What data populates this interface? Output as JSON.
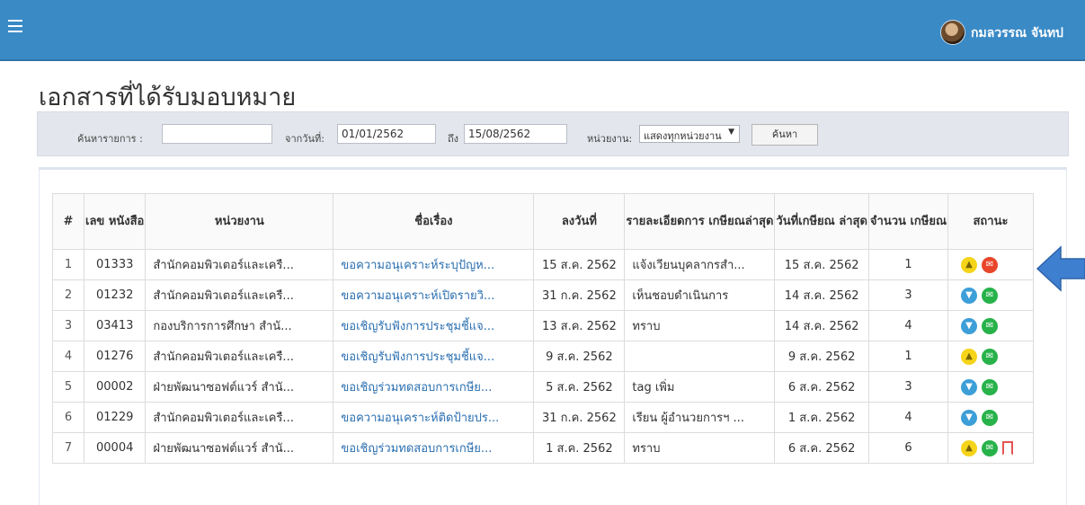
{
  "header": {
    "user_name": "กมลวรรณ จันทป",
    "menu_icon": "hamburger-icon",
    "avatar_icon": "user-avatar"
  },
  "page": {
    "title": "เอกสารที่ได้รับมอบหมาย"
  },
  "filter": {
    "search_label": "ค้นหารายการ :",
    "search_value": "",
    "from_label": "จากวันที่:",
    "from_value": "01/01/2562",
    "to_label": "ถึง",
    "to_value": "15/08/2562",
    "unit_label": "หน่วยงาน:",
    "unit_selected": "แสดงทุกหน่วยงาน",
    "search_button": "ค้นหา"
  },
  "table": {
    "columns": [
      "#",
      "เลข หนังสือ",
      "หน่วยงาน",
      "ชื่อเรื่อง",
      "ลงวันที่",
      "รายละเอียดการ เกษียณล่าสุด",
      "วันที่เกษียณ ล่าสุด",
      "จำนวน เกษียณ",
      "สถานะ"
    ],
    "rows": [
      {
        "no": "1",
        "doc_no": "01333",
        "unit": "สำนักคอมพิวเตอร์และเครื...",
        "subject": "ขอความอนุเคราะห์ระบุปัญห...",
        "date": "15 ส.ค. 2562",
        "detail": "แจ้งเวียนบุคลากรสำ...",
        "last_date": "15 ส.ค. 2562",
        "count": "1",
        "status": [
          "yellow",
          "red"
        ]
      },
      {
        "no": "2",
        "doc_no": "01232",
        "unit": "สำนักคอมพิวเตอร์และเครื...",
        "subject": "ขอความอนุเคราะห์เปิดรายวิ...",
        "date": "31 ก.ค. 2562",
        "detail": "เห็นชอบดำเนินการ",
        "last_date": "14 ส.ค. 2562",
        "count": "3",
        "status": [
          "blue",
          "green"
        ]
      },
      {
        "no": "3",
        "doc_no": "03413",
        "unit": "กองบริการการศึกษา สำนั...",
        "subject": "ขอเชิญรับฟังการประชุมชี้แจ...",
        "date": "13 ส.ค. 2562",
        "detail": "ทราบ",
        "last_date": "14 ส.ค. 2562",
        "count": "4",
        "status": [
          "blue",
          "green"
        ]
      },
      {
        "no": "4",
        "doc_no": "01276",
        "unit": "สำนักคอมพิวเตอร์และเครื...",
        "subject": "ขอเชิญรับฟังการประชุมชี้แจ...",
        "date": "9 ส.ค. 2562",
        "detail": "",
        "last_date": "9 ส.ค. 2562",
        "count": "1",
        "status": [
          "yellow",
          "green"
        ]
      },
      {
        "no": "5",
        "doc_no": "00002",
        "unit": "ฝ่ายพัฒนาซอฟต์แวร์ สำนั...",
        "subject": "ขอเชิญร่วมทดสอบการเกษีย...",
        "date": "5 ส.ค. 2562",
        "detail": "tag เพิ่ม",
        "last_date": "6 ส.ค. 2562",
        "count": "3",
        "status": [
          "blue",
          "green"
        ]
      },
      {
        "no": "6",
        "doc_no": "01229",
        "unit": "สำนักคอมพิวเตอร์และเครื...",
        "subject": "ขอความอนุเคราะห์ติดป้ายปร...",
        "date": "31 ก.ค. 2562",
        "detail": "เรียน ผู้อำนวยการฯ ...",
        "last_date": "1 ส.ค. 2562",
        "count": "4",
        "status": [
          "blue",
          "green"
        ]
      },
      {
        "no": "7",
        "doc_no": "00004",
        "unit": "ฝ่ายพัฒนาซอฟต์แวร์ สำนั...",
        "subject": "ขอเชิญร่วมทดสอบการเกษีย...",
        "date": "1 ส.ค. 2562",
        "detail": "ทราบ",
        "last_date": "6 ส.ค. 2562",
        "count": "6",
        "status": [
          "yellow",
          "green",
          "bookmark"
        ]
      }
    ]
  },
  "colors": {
    "topbar": "#3a8ac6",
    "link": "#2a6fb0",
    "status_yellow": "#f5d41a",
    "status_blue": "#3d9fd8",
    "status_green": "#27b24a",
    "status_red": "#e8452a",
    "bookmark": "#e35454",
    "pointer_arrow": "#3f7fd0"
  }
}
